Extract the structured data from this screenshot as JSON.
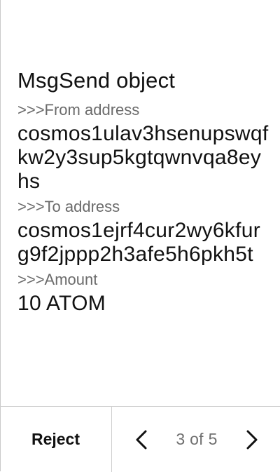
{
  "screen": {
    "title": "MsgSend object"
  },
  "fields": {
    "from": {
      "label": ">>>From address",
      "value": "cosmos1ulav3hsenupswqfkw2y3sup5kgtqwnvqa8eyhs"
    },
    "to": {
      "label": ">>>To address",
      "value": "cosmos1ejrf4cur2wy6kfurg9f2jppp2h3afe5h6pkh5t"
    },
    "amount": {
      "label": ">>>Amount",
      "value": "10 ATOM"
    }
  },
  "footer": {
    "reject_label": "Reject",
    "pager_text": "3 of 5",
    "prev_icon": "chevron-left-icon",
    "next_icon": "chevron-right-icon"
  },
  "colors": {
    "text": "#111111",
    "label": "#6b6b6b",
    "divider": "#cfcfcf"
  }
}
